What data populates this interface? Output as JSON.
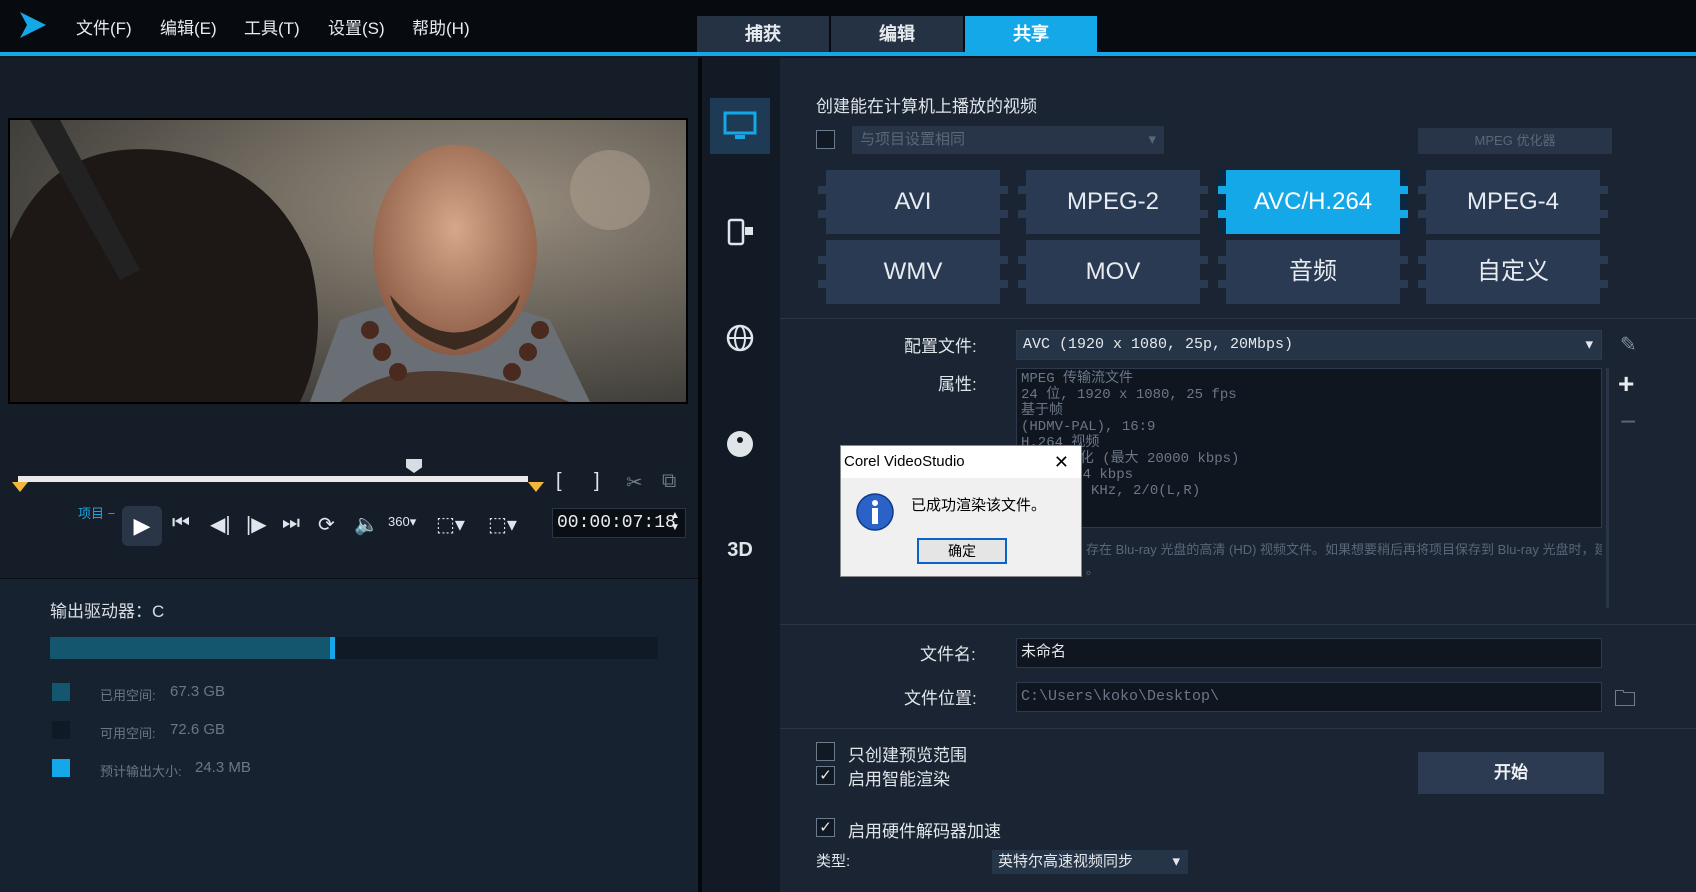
{
  "menu": {
    "file": "文件(F)",
    "edit": "编辑(E)",
    "tools": "工具(T)",
    "settings": "设置(S)",
    "help": "帮助(H)"
  },
  "top_tabs": {
    "capture": "捕获",
    "edit": "编辑",
    "share": "共享"
  },
  "player": {
    "project_label": "项目 −",
    "timecode": "00:00:07:18"
  },
  "storage": {
    "drive_label": "输出驱动器：C",
    "used_label": "已用空间:",
    "used_value": "67.3 GB",
    "free_label": "可用空间:",
    "free_value": "72.6 GB",
    "estimate_label": "预计输出大小:",
    "estimate_value": "24.3 MB",
    "used_fraction": 0.46,
    "colors": {
      "used": "#14566e",
      "free": "#0f1a26",
      "estimate": "#15a8e8"
    }
  },
  "share_panel": {
    "heading": "创建能在计算机上播放的视频",
    "same_as_project": "与项目设置相同",
    "mpeg_optimizer": "MPEG 优化器",
    "formats": [
      "AVI",
      "MPEG-2",
      "AVC/H.264",
      "MPEG-4",
      "WMV",
      "MOV",
      "音频",
      "自定义"
    ],
    "active_format": "AVC/H.264",
    "profile_label": "配置文件:",
    "profile_value": "AVC (1920 x 1080, 25p, 20Mbps)",
    "properties_label": "属性:",
    "properties_lines": [
      "MPEG 传输流文件",
      "24 位, 1920 x 1080, 25 fps",
      "基于帧",
      "(HDMV-PAL),  16:9",
      "H.264 视频",
      "速率: 变化 (最大 20000 kbps)",
      "速率: 384 kbps",
      "音频, 48 KHz, 2/0(L,R)"
    ],
    "description": "存在 Blu-ray 光盘的高清 (HD) 视频文件。如果想要稍后再将项目保存到 Blu-ray 光盘时，建",
    "description_tail": "。",
    "filename_label": "文件名:",
    "filename_value": "未命名",
    "location_label": "文件位置:",
    "location_value": "C:\\Users\\koko\\Desktop\\",
    "preview_range_only": "只创建预览范围",
    "smart_render": "启用智能渲染",
    "hw_decoder": "启用硬件解码器加速",
    "type_label": "类型:",
    "type_value": "英特尔高速视频同步",
    "start_button": "开始"
  },
  "dialog": {
    "title": "Corel VideoStudio",
    "message": "已成功渲染该文件。",
    "ok": "确定"
  },
  "icons": {
    "computer": "computer-icon",
    "device": "mobile-device-icon",
    "web": "globe-icon",
    "disc": "dvd-disc-icon",
    "three_d": "3d-icon"
  }
}
